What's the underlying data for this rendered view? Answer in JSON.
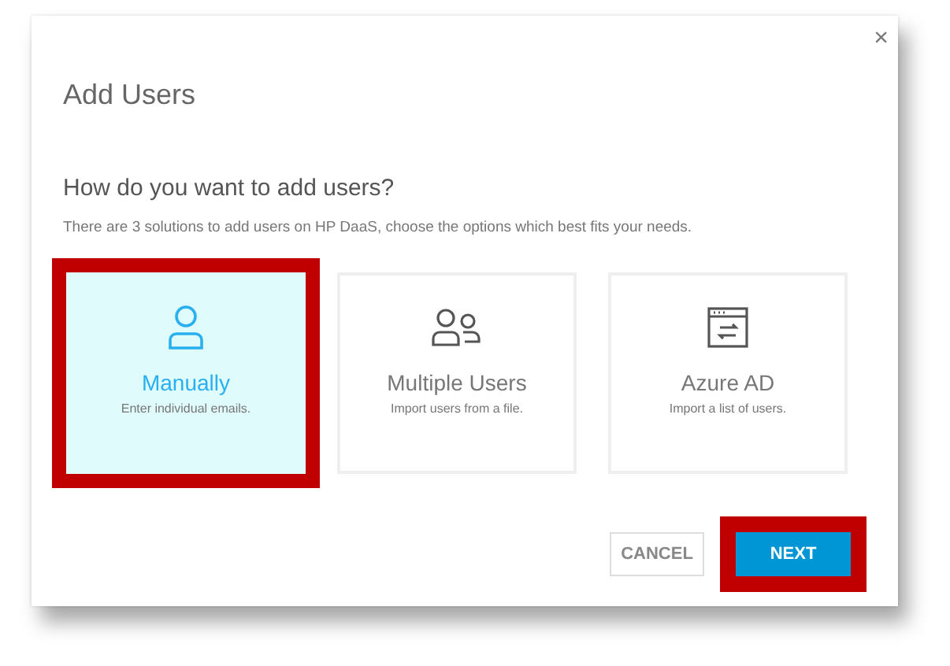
{
  "dialog": {
    "title": "Add Users",
    "close": "×",
    "question": "How do you want to add users?",
    "description": "There are 3 solutions to add users on HP DaaS, choose the options which best fits your needs."
  },
  "options": [
    {
      "kind": "user",
      "title": "Manually",
      "subtitle": "Enter individual emails.",
      "selected": true,
      "highlighted": true
    },
    {
      "kind": "users",
      "title": "Multiple Users",
      "subtitle": "Import users from a file.",
      "selected": false,
      "highlighted": false
    },
    {
      "kind": "directory",
      "title": "Azure AD",
      "subtitle": "Import a list of users.",
      "selected": false,
      "highlighted": false
    }
  ],
  "buttons": [
    {
      "kind": "secondary",
      "label": "CANCEL",
      "highlighted": false
    },
    {
      "kind": "primary",
      "label": "NEXT",
      "highlighted": true
    }
  ]
}
